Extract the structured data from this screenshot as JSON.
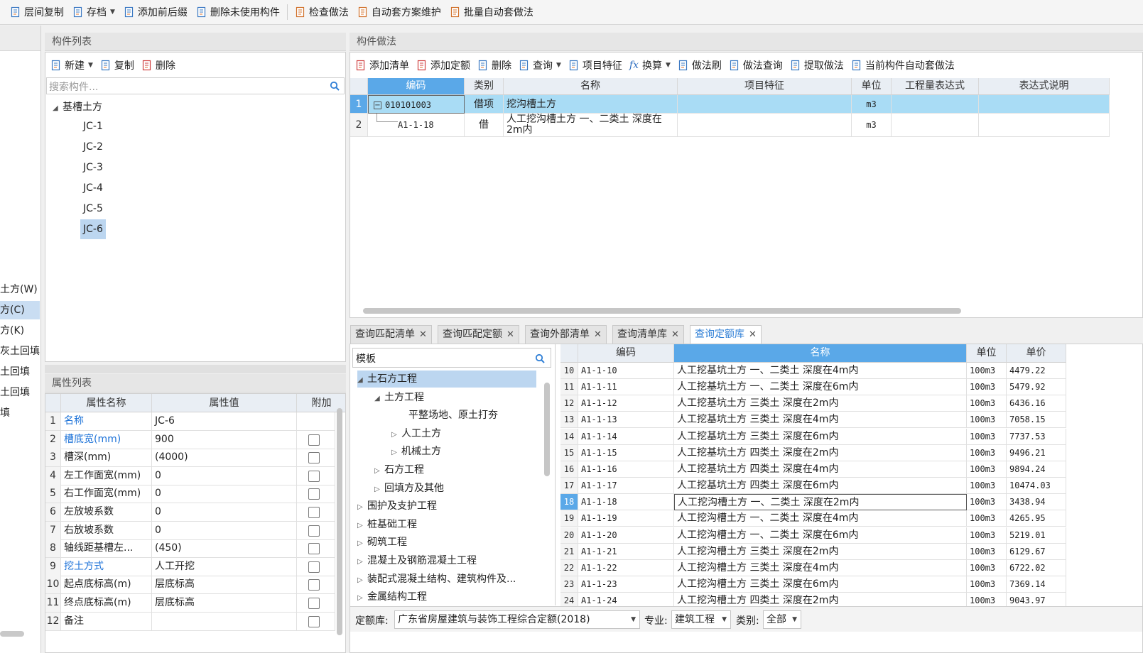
{
  "toolbar": [
    {
      "label": "层间复制",
      "icon": "copy-floor-icon"
    },
    {
      "label": "存档",
      "icon": "archive-icon",
      "dropdown": true
    },
    {
      "label": "添加前后缀",
      "icon": "add-prefix-icon"
    },
    {
      "label": "删除未使用构件",
      "icon": "delete-unused-icon"
    },
    {
      "label": "检查做法",
      "icon": "check-method-icon"
    },
    {
      "label": "自动套方案维护",
      "icon": "auto-scheme-icon"
    },
    {
      "label": "批量自动套做法",
      "icon": "batch-auto-icon"
    }
  ],
  "left_strip": [
    "土方(W)",
    "方(C)",
    "方(K)",
    "灰土回填",
    "土回填",
    "土回填",
    "填"
  ],
  "component_list": {
    "title": "构件列表",
    "actions": [
      {
        "label": "新建",
        "dropdown": true
      },
      {
        "label": "复制"
      },
      {
        "label": "删除"
      }
    ],
    "search_placeholder": "搜索构件...",
    "tree_root": "基槽土方",
    "items": [
      "JC-1",
      "JC-2",
      "JC-3",
      "JC-4",
      "JC-5",
      "JC-6"
    ],
    "selected": "JC-6"
  },
  "property_list": {
    "title": "属性列表",
    "headers": [
      "属性名称",
      "属性值",
      "附加"
    ],
    "rows": [
      {
        "n": "1",
        "name": "名称",
        "value": "JC-6",
        "blue": true,
        "check": false
      },
      {
        "n": "2",
        "name": "槽底宽(mm)",
        "value": "900",
        "blue": true,
        "check": true
      },
      {
        "n": "3",
        "name": "槽深(mm)",
        "value": "(4000)",
        "blue": false,
        "check": true
      },
      {
        "n": "4",
        "name": "左工作面宽(mm)",
        "value": "0",
        "blue": false,
        "check": true
      },
      {
        "n": "5",
        "name": "右工作面宽(mm)",
        "value": "0",
        "blue": false,
        "check": true
      },
      {
        "n": "6",
        "name": "左放坡系数",
        "value": "0",
        "blue": false,
        "check": true
      },
      {
        "n": "7",
        "name": "右放坡系数",
        "value": "0",
        "blue": false,
        "check": true
      },
      {
        "n": "8",
        "name": "轴线距基槽左...",
        "value": "(450)",
        "blue": false,
        "check": true
      },
      {
        "n": "9",
        "name": "挖土方式",
        "value": "人工开挖",
        "blue": true,
        "check": true
      },
      {
        "n": "10",
        "name": "起点底标高(m)",
        "value": "层底标高",
        "blue": false,
        "check": true
      },
      {
        "n": "11",
        "name": "终点底标高(m)",
        "value": "层底标高",
        "blue": false,
        "check": true
      },
      {
        "n": "12",
        "name": "备注",
        "value": "",
        "blue": false,
        "check": true
      }
    ]
  },
  "method": {
    "title": "构件做法",
    "actions": [
      {
        "label": "添加清单"
      },
      {
        "label": "添加定额"
      },
      {
        "label": "删除"
      },
      {
        "label": "查询",
        "dropdown": true
      },
      {
        "label": "项目特征"
      },
      {
        "label": "换算",
        "dropdown": true
      },
      {
        "label": "做法刷"
      },
      {
        "label": "做法查询"
      },
      {
        "label": "提取做法"
      },
      {
        "label": "当前构件自动套做法"
      }
    ],
    "headers": [
      "编码",
      "类别",
      "名称",
      "项目特征",
      "单位",
      "工程量表达式",
      "表达式说明"
    ],
    "rows": [
      {
        "n": "1",
        "code": "010101003",
        "type": "借项",
        "name": "挖沟槽土方",
        "unit": "m3"
      },
      {
        "n": "2",
        "code": "A1-1-18",
        "type": "借",
        "name": "人工挖沟槽土方 一、二类土 深度在2m内",
        "unit": "m3"
      }
    ]
  },
  "tabs": [
    {
      "label": "查询匹配清单",
      "active": false
    },
    {
      "label": "查询匹配定额",
      "active": false
    },
    {
      "label": "查询外部清单",
      "active": false
    },
    {
      "label": "查询清单库",
      "active": false
    },
    {
      "label": "查询定额库",
      "active": true
    }
  ],
  "query": {
    "search_value": "模板",
    "tree": [
      {
        "label": "土石方工程",
        "level": 0,
        "arrow": "open",
        "selected": true
      },
      {
        "label": "土方工程",
        "level": 1,
        "arrow": "open",
        "selected": false
      },
      {
        "label": "平整场地、原土打夯",
        "level": 2,
        "arrow": "",
        "selected": false
      },
      {
        "label": "人工土方",
        "level": 2,
        "arrow": "closed",
        "selected": false
      },
      {
        "label": "机械土方",
        "level": 2,
        "arrow": "closed",
        "selected": false
      },
      {
        "label": "石方工程",
        "level": 1,
        "arrow": "closed",
        "selected": false
      },
      {
        "label": "回填方及其他",
        "level": 1,
        "arrow": "closed",
        "selected": false
      },
      {
        "label": "围护及支护工程",
        "level": 0,
        "arrow": "closed",
        "selected": false
      },
      {
        "label": "桩基础工程",
        "level": 0,
        "arrow": "closed",
        "selected": false
      },
      {
        "label": "砌筑工程",
        "level": 0,
        "arrow": "closed",
        "selected": false
      },
      {
        "label": "混凝土及钢筋混凝土工程",
        "level": 0,
        "arrow": "closed",
        "selected": false
      },
      {
        "label": "装配式混凝土结构、建筑构件及...",
        "level": 0,
        "arrow": "closed",
        "selected": false
      },
      {
        "label": "金属结构工程",
        "level": 0,
        "arrow": "closed",
        "selected": false
      }
    ],
    "headers": [
      "编码",
      "名称",
      "单位",
      "单价"
    ],
    "rows": [
      {
        "n": "10",
        "code": "A1-1-10",
        "name": "人工挖基坑土方 一、二类土 深度在4m内",
        "unit": "100m3",
        "price": "4479.22"
      },
      {
        "n": "11",
        "code": "A1-1-11",
        "name": "人工挖基坑土方 一、二类土 深度在6m内",
        "unit": "100m3",
        "price": "5479.92"
      },
      {
        "n": "12",
        "code": "A1-1-12",
        "name": "人工挖基坑土方 三类土 深度在2m内",
        "unit": "100m3",
        "price": "6436.16"
      },
      {
        "n": "13",
        "code": "A1-1-13",
        "name": "人工挖基坑土方 三类土 深度在4m内",
        "unit": "100m3",
        "price": "7058.15"
      },
      {
        "n": "14",
        "code": "A1-1-14",
        "name": "人工挖基坑土方 三类土 深度在6m内",
        "unit": "100m3",
        "price": "7737.53"
      },
      {
        "n": "15",
        "code": "A1-1-15",
        "name": "人工挖基坑土方 四类土 深度在2m内",
        "unit": "100m3",
        "price": "9496.21"
      },
      {
        "n": "16",
        "code": "A1-1-16",
        "name": "人工挖基坑土方 四类土 深度在4m内",
        "unit": "100m3",
        "price": "9894.24"
      },
      {
        "n": "17",
        "code": "A1-1-17",
        "name": "人工挖基坑土方 四类土 深度在6m内",
        "unit": "100m3",
        "price": "10474.03"
      },
      {
        "n": "18",
        "code": "A1-1-18",
        "name": "人工挖沟槽土方 一、二类土 深度在2m内",
        "unit": "100m3",
        "price": "3438.94"
      },
      {
        "n": "19",
        "code": "A1-1-19",
        "name": "人工挖沟槽土方 一、二类土 深度在4m内",
        "unit": "100m3",
        "price": "4265.95"
      },
      {
        "n": "20",
        "code": "A1-1-20",
        "name": "人工挖沟槽土方 一、二类土 深度在6m内",
        "unit": "100m3",
        "price": "5219.01"
      },
      {
        "n": "21",
        "code": "A1-1-21",
        "name": "人工挖沟槽土方 三类土 深度在2m内",
        "unit": "100m3",
        "price": "6129.67"
      },
      {
        "n": "22",
        "code": "A1-1-22",
        "name": "人工挖沟槽土方 三类土 深度在4m内",
        "unit": "100m3",
        "price": "6722.02"
      },
      {
        "n": "23",
        "code": "A1-1-23",
        "name": "人工挖沟槽土方 三类土 深度在6m内",
        "unit": "100m3",
        "price": "7369.14"
      },
      {
        "n": "24",
        "code": "A1-1-24",
        "name": "人工挖沟槽土方 四类土 深度在2m内",
        "unit": "100m3",
        "price": "9043.97"
      }
    ],
    "selected_row": "18",
    "footer": {
      "db_label": "定额库:",
      "db_value": "广东省房屋建筑与装饰工程综合定额(2018)",
      "major_label": "专业:",
      "major_value": "建筑工程",
      "type_label": "类别:",
      "type_value": "全部"
    }
  },
  "colors": {
    "selected_bg": "#a9dcf5",
    "header_active": "#5aa8e8",
    "link_blue": "#1e73d8"
  }
}
